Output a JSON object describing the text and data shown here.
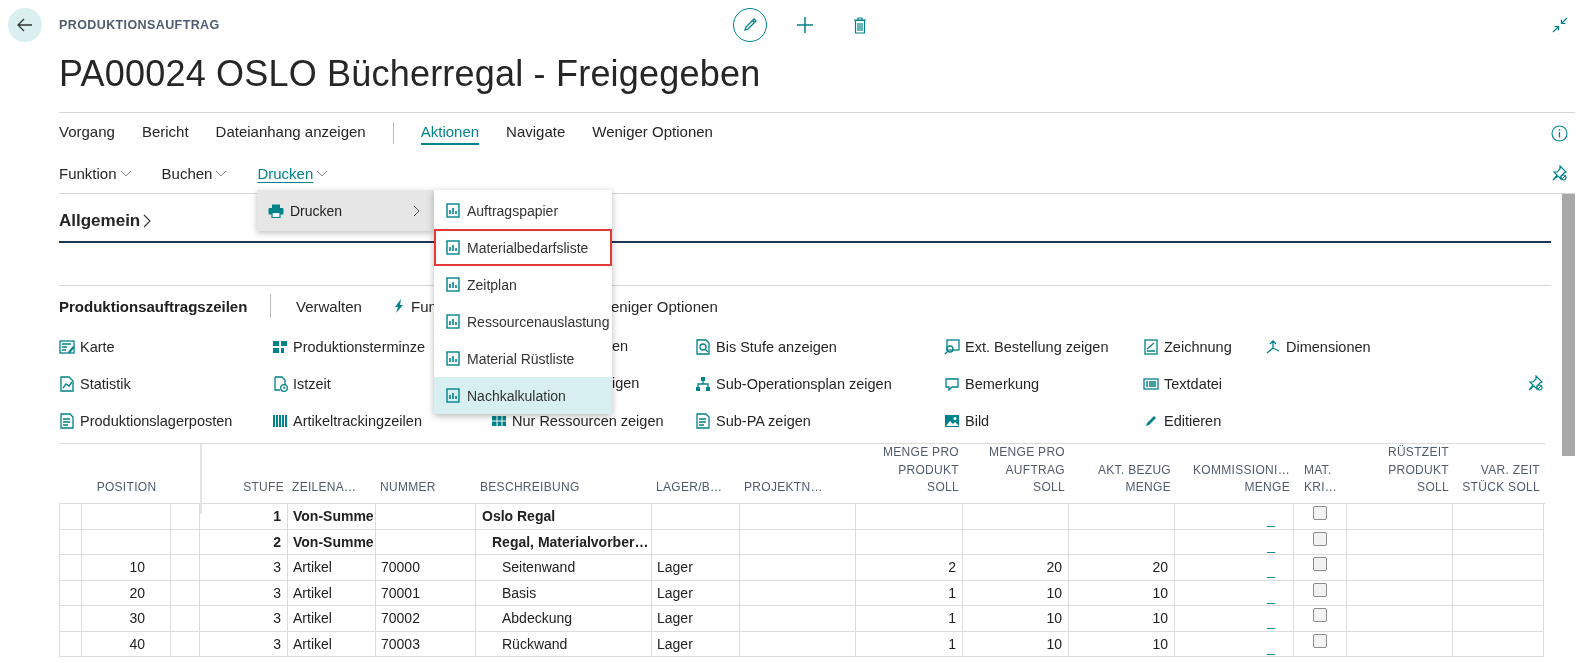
{
  "page": {
    "caption": "PRODUKTIONSAUFTRAG",
    "title": "PA00024 OSLO Bücherregal - Freigegeben"
  },
  "action_groups": [
    [
      {
        "label": "Vorgang",
        "selected": false
      },
      {
        "label": "Bericht",
        "selected": false
      },
      {
        "label": "Dateianhang anzeigen",
        "selected": false
      }
    ],
    [
      {
        "label": "Aktionen",
        "selected": true
      },
      {
        "label": "Navigate",
        "selected": false
      },
      {
        "label": "Weniger Optionen",
        "selected": false
      }
    ]
  ],
  "action_menus": [
    {
      "label": "Funktion",
      "open": false
    },
    {
      "label": "Buchen",
      "open": false
    },
    {
      "label": "Drucken",
      "open": true
    }
  ],
  "dropdown": {
    "label": "Drucken",
    "highlighted": true
  },
  "submenu": [
    {
      "label": "Auftragspapier",
      "highlighted": false,
      "outlined": false
    },
    {
      "label": "Materialbedarfsliste",
      "highlighted": false,
      "outlined": true
    },
    {
      "label": "Zeitplan",
      "highlighted": false,
      "outlined": false
    },
    {
      "label": "Ressourcenauslastung",
      "highlighted": false,
      "outlined": false
    },
    {
      "label": "Material Rüstliste",
      "highlighted": false,
      "outlined": false
    },
    {
      "label": "Nachkalkulation",
      "highlighted": true,
      "outlined": false
    }
  ],
  "section": {
    "label": "Allgemein"
  },
  "lines_part": {
    "title": "Produktionsauftragszeilen",
    "toolbar": [
      {
        "label": "Verwalten",
        "kind": "action"
      },
      {
        "label": "Fun",
        "kind": "action"
      },
      {
        "label": "eniger Optionen",
        "kind": "fragment"
      }
    ],
    "actions": [
      [
        {
          "label": "Karte",
          "kind": "action"
        },
        {
          "label": "Statistik",
          "kind": "action"
        },
        {
          "label": "Produktionslagerposten",
          "kind": "action"
        }
      ],
      [
        {
          "label": "Produktionsterminze",
          "kind": "action"
        },
        {
          "label": "Istzeit",
          "kind": "action"
        },
        {
          "label": "Artikeltrackingzeilen",
          "kind": "action"
        }
      ],
      [
        {
          "label": "en",
          "kind": "fragment"
        },
        {
          "label": "igen",
          "kind": "fragment"
        },
        {
          "label": "Nur Ressourcen zeigen",
          "kind": "action"
        }
      ],
      [
        {
          "label": "Bis Stufe anzeigen",
          "kind": "action"
        },
        {
          "label": "Sub-Operationsplan zeigen",
          "kind": "action"
        },
        {
          "label": "Sub-PA zeigen",
          "kind": "action"
        }
      ],
      [
        {
          "label": "Ext. Bestellung zeigen",
          "kind": "action"
        },
        {
          "label": "Bemerkung",
          "kind": "action"
        },
        {
          "label": "Bild",
          "kind": "action"
        }
      ],
      [
        {
          "label": "Zeichnung",
          "kind": "action"
        },
        {
          "label": "Textdatei",
          "kind": "action"
        },
        {
          "label": "Editieren",
          "kind": "action"
        }
      ],
      [
        {
          "label": "Dimensionen",
          "kind": "action"
        }
      ]
    ]
  },
  "table": {
    "columns": [
      {
        "label": "POSITION",
        "kind": "text"
      },
      {
        "label": "STUFE",
        "kind": "text"
      },
      {
        "label": "ZEILENA…",
        "kind": "text"
      },
      {
        "label": "NUMMER",
        "kind": "text"
      },
      {
        "label": "BESCHREIBUNG",
        "kind": "description"
      },
      {
        "label": "LAGER/B…",
        "kind": "text"
      },
      {
        "label": "PROJEKTN…",
        "kind": "text"
      },
      {
        "label": "MENGE PRO\nPRODUKT\nSOLL",
        "kind": "text"
      },
      {
        "label": "MENGE PRO\nAUFTRAG\nSOLL",
        "kind": "text"
      },
      {
        "label": "AKT. BEZUG\nMENGE",
        "kind": "text"
      },
      {
        "label": "KOMMISSIONI…\nMENGE",
        "kind": "link"
      },
      {
        "label": "MAT.\nKRI…",
        "kind": "checkbox"
      },
      {
        "label": "RÜSTZEIT\nPRODUKT\nSOLL",
        "kind": "text"
      },
      {
        "label": "VAR. ZEIT\nSTÜCK SOLL",
        "kind": "text"
      }
    ],
    "rows": [
      {
        "kind": "total",
        "checked": false,
        "cells": [
          null,
          "1",
          "Von-Summe",
          null,
          "Oslo Regal",
          null,
          null,
          null,
          null,
          null,
          "_",
          null,
          null,
          null
        ]
      },
      {
        "kind": "total",
        "checked": false,
        "cells": [
          null,
          "2",
          "Von-Summe",
          null,
          "Regal, Materialvorber…",
          null,
          null,
          null,
          null,
          null,
          "_",
          null,
          null,
          null
        ]
      },
      {
        "kind": "item",
        "checked": false,
        "cells": [
          "10",
          "3",
          "Artikel",
          "70000",
          "Seitenwand",
          "Lager",
          null,
          "2",
          "20",
          "20",
          "_",
          null,
          null,
          null
        ]
      },
      {
        "kind": "item",
        "checked": false,
        "cells": [
          "20",
          "3",
          "Artikel",
          "70001",
          "Basis",
          "Lager",
          null,
          "1",
          "10",
          "10",
          "_",
          null,
          null,
          null
        ]
      },
      {
        "kind": "item",
        "checked": false,
        "cells": [
          "30",
          "3",
          "Artikel",
          "70002",
          "Abdeckung",
          "Lager",
          null,
          "1",
          "10",
          "10",
          "_",
          null,
          null,
          null
        ]
      },
      {
        "kind": "item",
        "checked": false,
        "cells": [
          "40",
          "3",
          "Artikel",
          "70003",
          "Rückwand",
          "Lager",
          null,
          "1",
          "10",
          "10",
          "_",
          null,
          null,
          null
        ]
      }
    ]
  }
}
